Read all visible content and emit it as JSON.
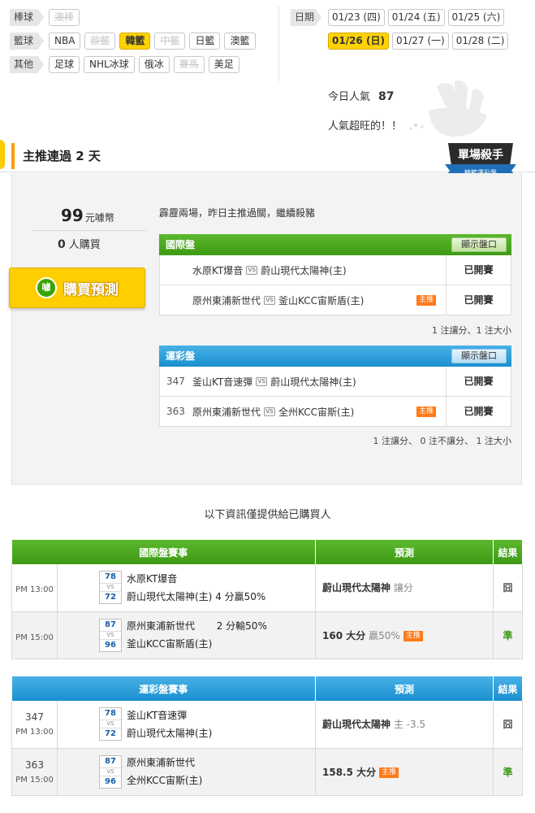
{
  "filters": {
    "rows": [
      {
        "label": "棒球",
        "items": [
          {
            "text": "澳棒",
            "state": "disabled"
          }
        ]
      },
      {
        "label": "籃球",
        "items": [
          {
            "text": "NBA",
            "state": "normal"
          },
          {
            "text": "歐籃",
            "state": "disabled"
          },
          {
            "text": "韓籃",
            "state": "selected"
          },
          {
            "text": "中籃",
            "state": "disabled"
          },
          {
            "text": "日籃",
            "state": "normal"
          },
          {
            "text": "澳籃",
            "state": "normal"
          }
        ]
      },
      {
        "label": "其他",
        "items": [
          {
            "text": "足球",
            "state": "normal"
          },
          {
            "text": "NHL冰球",
            "state": "normal"
          },
          {
            "text": "俄冰",
            "state": "normal"
          },
          {
            "text": "賽馬",
            "state": "disabled"
          },
          {
            "text": "美足",
            "state": "normal"
          }
        ]
      }
    ]
  },
  "dates": {
    "label": "日期",
    "row1": [
      "01/23 (四)",
      "01/24 (五)",
      "01/25 (六)"
    ],
    "row2": [
      "01/26 (日)",
      "01/27 (一)",
      "01/28 (二)"
    ],
    "selected": "01/26 (日)"
  },
  "popularity": {
    "label": "今日人氣",
    "value": "87",
    "comment": "人氣超旺的！！"
  },
  "section": {
    "title": "主推連過 2 天",
    "badge_title": "單場殺手",
    "badge_sub": "韓籃運彩盤"
  },
  "purchase": {
    "price": "99",
    "price_unit": "元噱幣",
    "buyers": "0",
    "buyers_unit": "人購買",
    "button_label": "購買預測",
    "button_icon_text": "噱"
  },
  "note": "霹靂兩場，昨日主推過關，繼續殺豬",
  "intl_market": {
    "title": "國際盤",
    "show_button": "顯示盤口",
    "rows": [
      {
        "code": "",
        "away": "水原KT爆音",
        "home": "蔚山現代太陽神(主)",
        "main": "",
        "status": "已開賽"
      },
      {
        "code": "",
        "away": "原州東浦新世代",
        "home": "釜山KCC宙斯盾(主)",
        "main": "主推",
        "status": "已開賽"
      }
    ],
    "summary": "1 注讓分、1 注大小"
  },
  "lottery_market": {
    "title": "運彩盤",
    "show_button": "顯示盤口",
    "rows": [
      {
        "code": "347",
        "away": "釜山KT音速彈",
        "home": "蔚山現代太陽神(主)",
        "main": "",
        "status": "已開賽"
      },
      {
        "code": "363",
        "away": "原州東浦新世代",
        "home": "全州KCC宙斯(主)",
        "main": "主推",
        "status": "已開賽"
      }
    ],
    "summary": "1 注讓分、 0 注不讓分、 1 注大小"
  },
  "vs_label": "VS",
  "center_note": "以下資訊僅提供給已購買人",
  "intl_table": {
    "headers": [
      "國際盤賽事",
      "預測",
      "結果"
    ],
    "rows": [
      {
        "code": "",
        "time": "PM 13:00",
        "away_score": "78",
        "home_score": "72",
        "away": "水原KT爆音",
        "home": "蔚山現代太陽神(主)",
        "home_note": "4 分贏50%",
        "away_note": "",
        "pred_main": "蔚山現代太陽神",
        "pred_extra": "讓分",
        "tag": "",
        "result": "囧"
      },
      {
        "code": "",
        "time": "PM 15:00",
        "away_score": "87",
        "home_score": "96",
        "away": "原州東浦新世代",
        "home": "釜山KCC宙斯盾(主)",
        "home_note": "",
        "away_note": "2 分輸50%",
        "pred_main": "160 大分",
        "pred_extra": "贏50%",
        "tag": "主推",
        "result": "準"
      }
    ]
  },
  "lottery_table": {
    "headers": [
      "運彩盤賽事",
      "預測",
      "結果"
    ],
    "rows": [
      {
        "code": "347",
        "time": "PM 13:00",
        "away_score": "78",
        "home_score": "72",
        "away": "釜山KT音速彈",
        "home": "蔚山現代太陽神(主)",
        "home_note": "",
        "away_note": "",
        "pred_main": "蔚山現代太陽神",
        "pred_extra": "主 -3.5",
        "tag": "",
        "result": "囧"
      },
      {
        "code": "363",
        "time": "PM 15:00",
        "away_score": "87",
        "home_score": "96",
        "away": "原州東浦新世代",
        "home": "全州KCC宙斯(主)",
        "home_note": "",
        "away_note": "",
        "pred_main": "158.5 大分",
        "pred_extra": "",
        "tag": "主推",
        "result": "準"
      }
    ]
  },
  "colors": {
    "accent_yellow": "#ffd200",
    "green_header": "#4caa22",
    "blue_header": "#2a9ad8",
    "main_tag": "#ff7a1a"
  }
}
